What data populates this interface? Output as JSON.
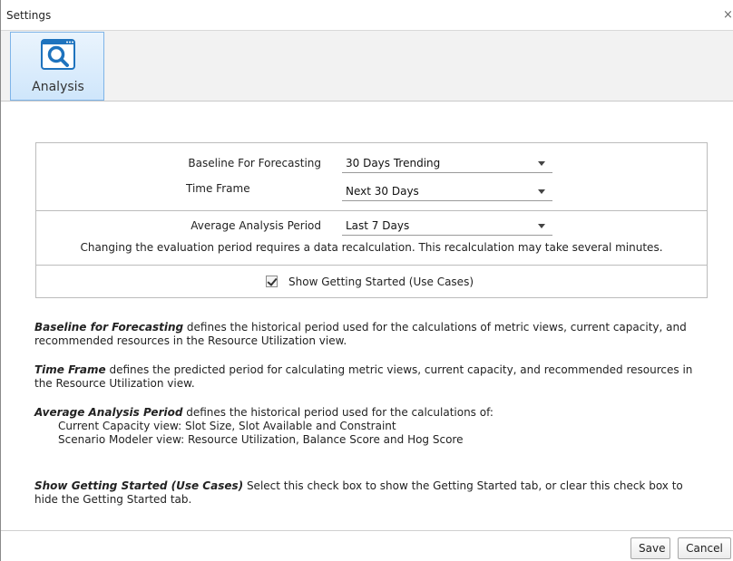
{
  "window": {
    "title": "Settings",
    "close_glyph": "×"
  },
  "tabs": [
    {
      "label": "Analysis",
      "icon": "search-icon",
      "selected": true
    }
  ],
  "settings": {
    "baseline": {
      "label": "Baseline For Forecasting",
      "value": "30 Days Trending"
    },
    "timeframe": {
      "label": "Time Frame",
      "value": "Next 30 Days"
    },
    "avg_period": {
      "label": "Average Analysis Period",
      "value": "Last 7 Days"
    },
    "recalc_note": "Changing the evaluation period requires a data recalculation. This recalculation may take several minutes.",
    "getting_started": {
      "label": "Show Getting Started (Use Cases)",
      "checked": true
    }
  },
  "help": {
    "baseline": {
      "term": "Baseline for Forecasting",
      "text": " defines the historical period used for the calculations of metric views, current capacity, and recommended resources in the Resource Utilization view."
    },
    "timeframe": {
      "term": "Time Frame",
      "text": " defines the predicted period for calculating metric views, current capacity, and recommended resources in the Resource Utilization view."
    },
    "avg_period": {
      "term": "Average Analysis Period",
      "text": " defines the historical period used for the calculations of:",
      "items": [
        "Current Capacity view: Slot Size, Slot Available and Constraint",
        "Scenario Modeler view: Resource Utilization, Balance Score and Hog Score"
      ]
    },
    "getting_started": {
      "term": "Show Getting Started (Use Cases)",
      "text": " Select this check box to show the Getting Started tab, or clear this check box to hide the Getting Started tab."
    }
  },
  "footer": {
    "save_label": "Save",
    "cancel_label": "Cancel"
  },
  "colors": {
    "tab_border": "#7eb4e8",
    "tab_fill": "#cfe6fb",
    "icon_blue": "#1e73be"
  }
}
